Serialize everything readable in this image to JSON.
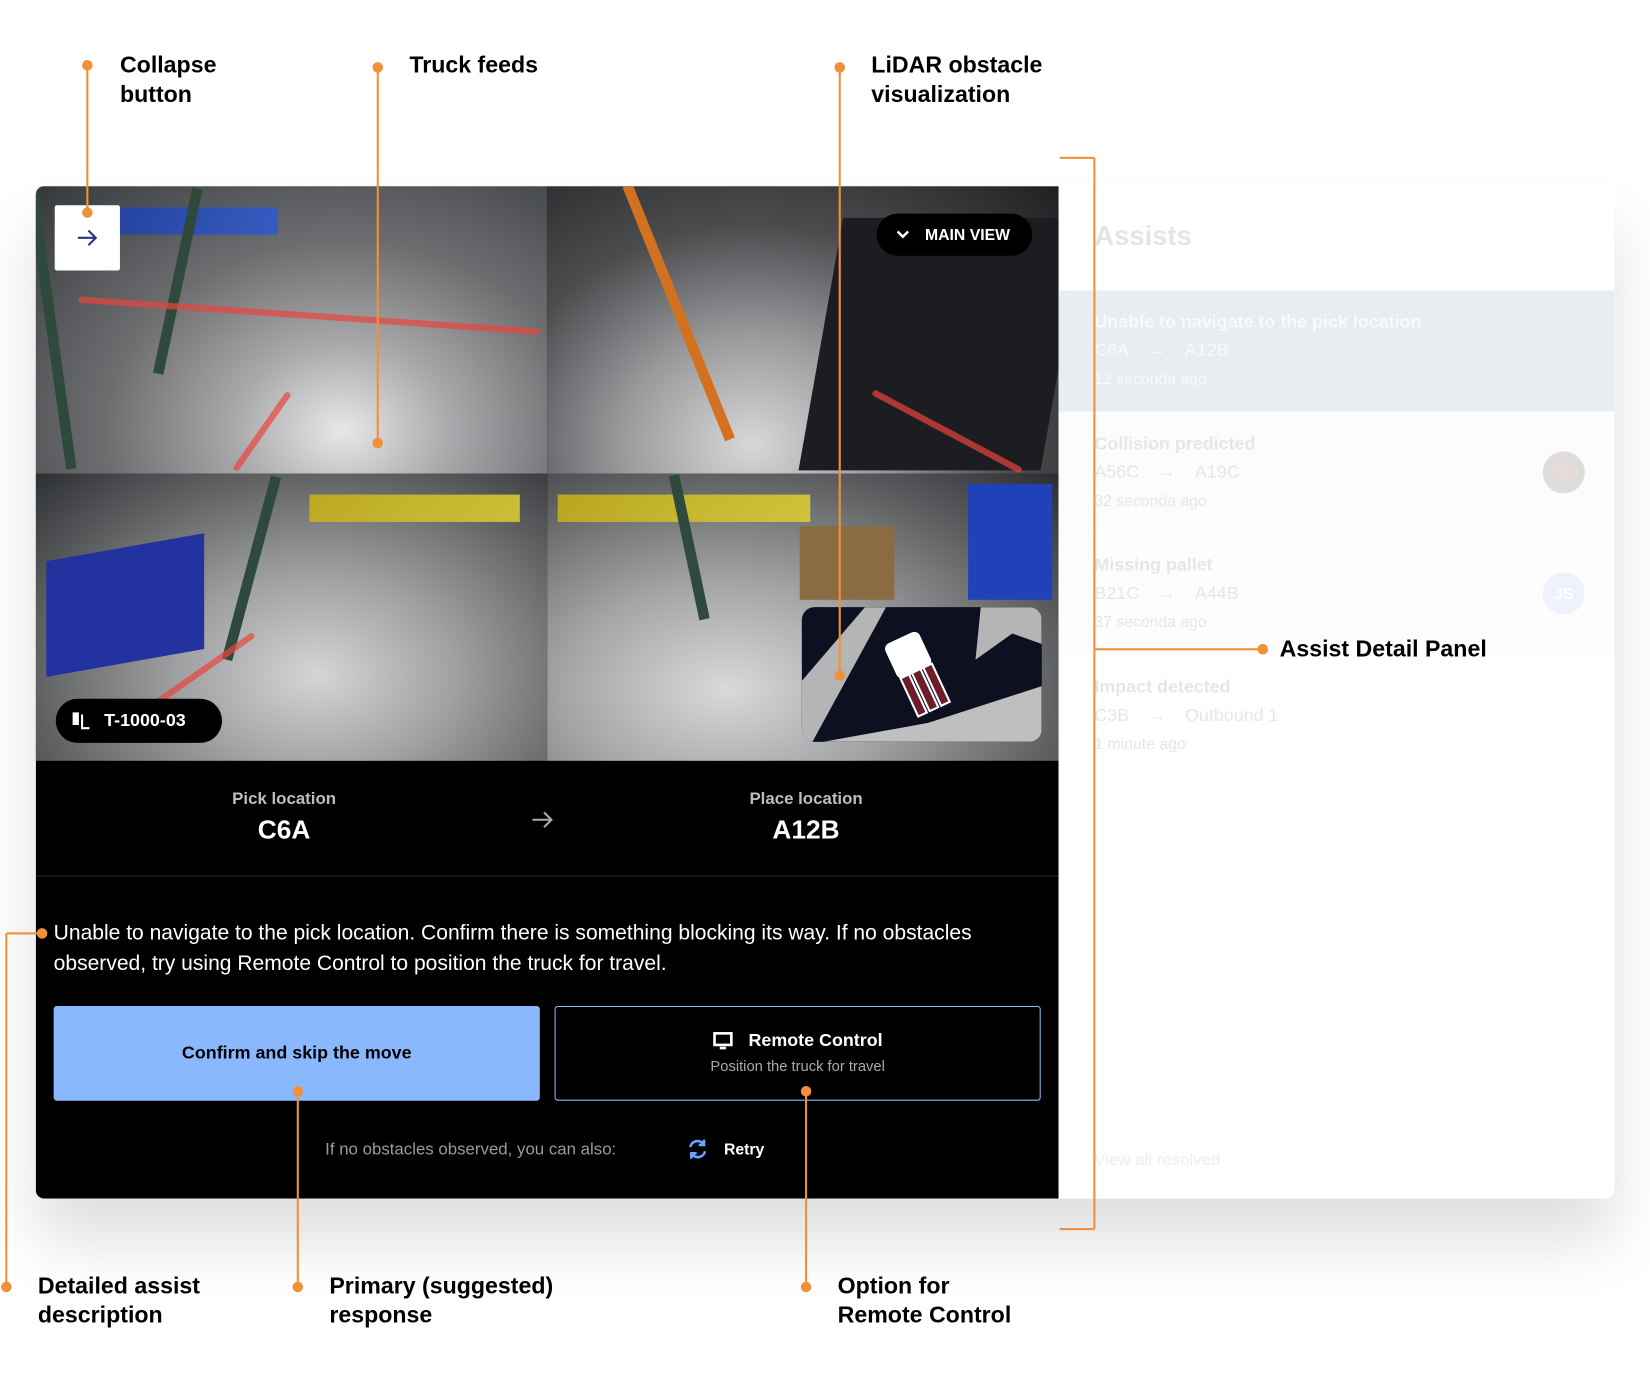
{
  "colors": {
    "accent": "#8ab8ff",
    "annotation": "#f0913a",
    "background": "#000000"
  },
  "annotations": {
    "collapse": "Collapse button",
    "feeds": "Truck feeds",
    "lidar": "LiDAR obstacle visualization",
    "panel": "Assist Detail Panel",
    "description": "Detailed assist description",
    "primary": "Primary (suggested) response",
    "remote": "Option for Remote Control"
  },
  "main": {
    "collapse_icon": "arrow-right-icon",
    "view_selector": "MAIN VIEW",
    "truck_id": "T-1000-03",
    "pick": {
      "label": "Pick location",
      "value": "C6A"
    },
    "place": {
      "label": "Place location",
      "value": "A12B"
    },
    "description": "Unable to navigate to the pick location. Confirm there is something blocking its way. If no obstacles observed, try using Remote Control to position the truck for travel.",
    "primary_button": "Confirm and skip the move",
    "remote_button": {
      "title": "Remote Control",
      "subtitle": "Position the truck for travel",
      "icon": "monitor-icon"
    },
    "also_text": "If no obstacles observed, you can also:",
    "retry_label": "Retry"
  },
  "sidebar": {
    "title": "Assists",
    "items": [
      {
        "title": "Unable to navigate to the pick location",
        "from": "C6A",
        "to": "A12B",
        "time": "12 seconda ago",
        "selected": true
      },
      {
        "title": "Collision predicted",
        "from": "A56C",
        "to": "A19C",
        "time": "32 seconda ago",
        "avatar": "photo"
      },
      {
        "title": "Missing pallet",
        "from": "B21C",
        "to": "A44B",
        "time": "37 seconda ago",
        "avatar": "JS"
      },
      {
        "title": "Impact detected",
        "from": "C3B",
        "to": "Outbound 1",
        "time": "1 minute ago"
      }
    ],
    "view_all": "View all resolved"
  }
}
